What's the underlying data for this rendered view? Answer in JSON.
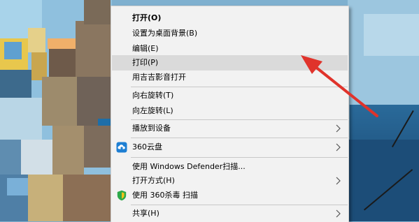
{
  "context_menu": {
    "items": [
      {
        "label": "打开(O)"
      },
      {
        "label": "设置为桌面背景(B)"
      },
      {
        "label": "编辑(E)"
      },
      {
        "label": "打印(P)"
      },
      {
        "label": "用吉吉影音打开"
      },
      {
        "label": "向右旋转(T)"
      },
      {
        "label": "向左旋转(L)"
      },
      {
        "label": "播放到设备"
      },
      {
        "label": "360云盘"
      },
      {
        "label": "使用 Windows Defender扫描..."
      },
      {
        "label": "打开方式(H)"
      },
      {
        "label": "使用 360杀毒 扫描"
      },
      {
        "label": "共享(H)"
      }
    ],
    "submenu_icon": "chevron-right-icon",
    "icons": {
      "cloud": "360-cloud-icon",
      "shield": "360-antivirus-shield-icon"
    }
  },
  "colors": {
    "menu_bg": "#f2f2f2",
    "hover_bg": "#dadada",
    "separator": "#c8c8c8",
    "annotation_arrow": "#e0332b",
    "cloud_icon": "#1e7fd3",
    "shield_icon": "#2da94a"
  },
  "annotation": {
    "icon": "red-arrow-icon",
    "points_to": "打印(P)"
  }
}
